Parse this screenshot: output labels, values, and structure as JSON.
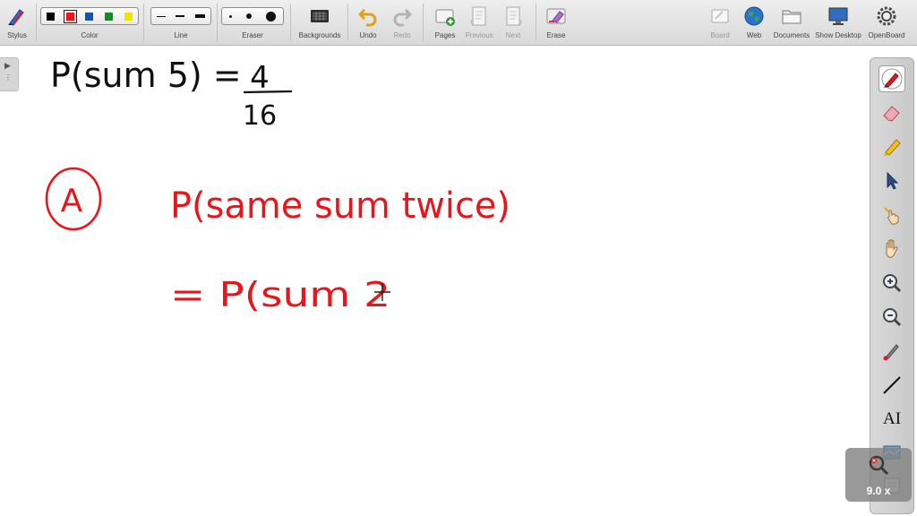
{
  "toolbar": {
    "stylus": "Stylus",
    "color": "Color",
    "line": "Line",
    "eraser": "Eraser",
    "backgrounds": "Backgrounds",
    "undo": "Undo",
    "redo": "Redo",
    "pages": "Pages",
    "previous": "Previous",
    "next": "Next",
    "erase": "Erase",
    "board": "Board",
    "web": "Web",
    "documents": "Documents",
    "show_desktop": "Show Desktop",
    "openboard": "OpenBoard"
  },
  "colors": {
    "swatches": [
      "#000000",
      "#e8161b",
      "#1456a8",
      "#158c2a",
      "#f5e200"
    ],
    "selected": "#e8161b",
    "ink_black": "#111111",
    "ink_red": "#e8161b"
  },
  "board": {
    "line1": {
      "text": "P(sum 5) = ",
      "numerator": "4",
      "denominator": "16"
    },
    "label_circle": "A",
    "line2": "P(same sum twice)",
    "line3": "= P(sum 2"
  },
  "right_palette": {
    "tools": [
      "pen-icon",
      "eraser-icon",
      "highlighter-icon",
      "selector-icon",
      "interact-hand-icon",
      "pan-hand-icon",
      "zoom-in-icon",
      "zoom-out-icon",
      "laser-pointer-icon",
      "line-icon",
      "text-icon",
      "capture-icon"
    ],
    "text_tool_label": "AI"
  },
  "zoom": {
    "label": "9.0 x"
  }
}
